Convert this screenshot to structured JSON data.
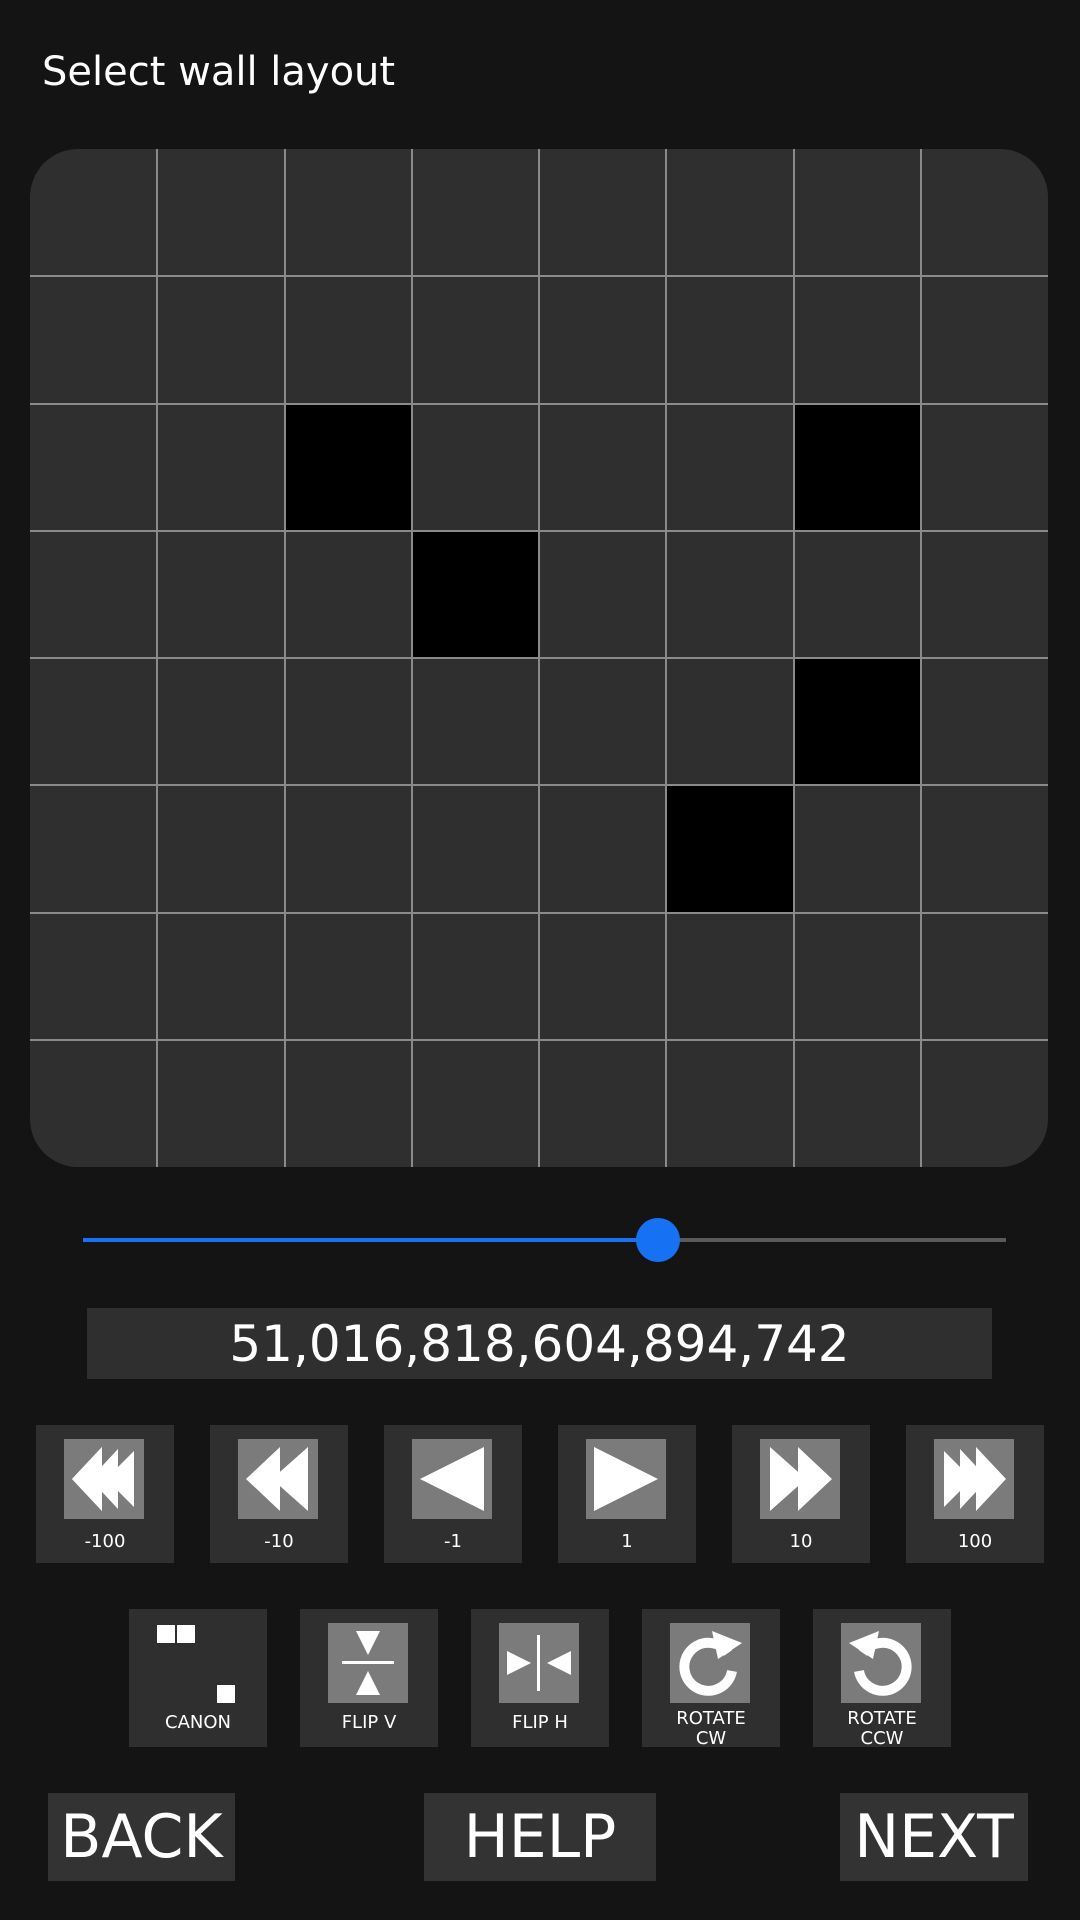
{
  "title": "Select wall layout",
  "grid": {
    "rows": 8,
    "cols": 8,
    "walls": [
      [
        2,
        2
      ],
      [
        2,
        6
      ],
      [
        3,
        3
      ],
      [
        4,
        6
      ],
      [
        5,
        5
      ]
    ]
  },
  "slider": {
    "value_fraction": 0.623
  },
  "counter": "51,016,818,604,894,742",
  "step_buttons": [
    {
      "label": "-100",
      "icon": "triple-left-arrow-icon"
    },
    {
      "label": "-10",
      "icon": "double-left-arrow-icon"
    },
    {
      "label": "-1",
      "icon": "left-arrow-icon"
    },
    {
      "label": "1",
      "icon": "right-arrow-icon"
    },
    {
      "label": "10",
      "icon": "double-right-arrow-icon"
    },
    {
      "label": "100",
      "icon": "triple-right-arrow-icon"
    }
  ],
  "transform_buttons": [
    {
      "label": "CANON",
      "icon": "canon-icon"
    },
    {
      "label": "FLIP V",
      "icon": "flip-vertical-icon"
    },
    {
      "label": "FLIP H",
      "icon": "flip-horizontal-icon"
    },
    {
      "label_line1": "ROTATE",
      "label_line2": "CW",
      "icon": "rotate-cw-icon"
    },
    {
      "label_line1": "ROTATE",
      "label_line2": "CCW",
      "icon": "rotate-ccw-icon"
    }
  ],
  "nav": {
    "back": "BACK",
    "help": "HELP",
    "next": "NEXT"
  },
  "colors": {
    "background": "#141414",
    "panel": "#2f2f2f",
    "wall": "#000000",
    "accent": "#1672f2"
  }
}
